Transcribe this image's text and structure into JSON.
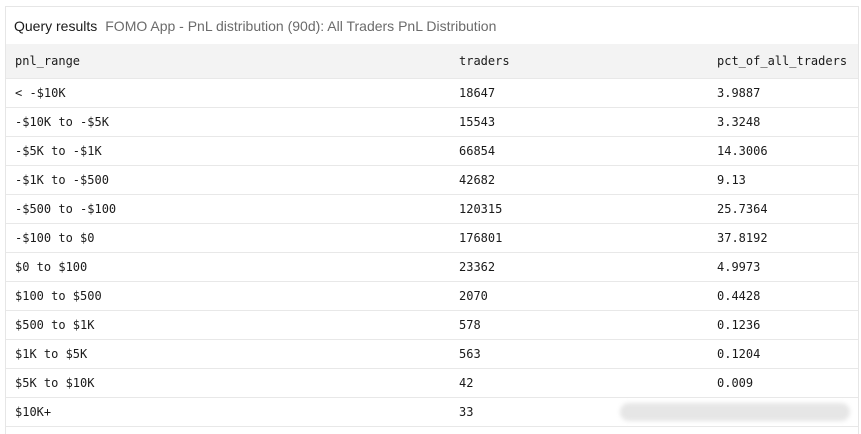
{
  "header": {
    "title": "Query results",
    "query_name": "FOMO App - PnL distribution (90d): All Traders PnL Distribution"
  },
  "table": {
    "columns": [
      "pnl_range",
      "traders",
      "pct_of_all_traders"
    ],
    "rows": [
      [
        "< -$10K",
        "18647",
        "3.9887"
      ],
      [
        "-$10K to -$5K",
        "15543",
        "3.3248"
      ],
      [
        "-$5K to -$1K",
        "66854",
        "14.3006"
      ],
      [
        "-$1K to -$500",
        "42682",
        "9.13"
      ],
      [
        "-$500 to -$100",
        "120315",
        "25.7364"
      ],
      [
        "-$100 to $0",
        "176801",
        "37.8192"
      ],
      [
        "$0 to $100",
        "23362",
        "4.9973"
      ],
      [
        "$100 to $500",
        "2070",
        "0.4428"
      ],
      [
        "$500 to $1K",
        "578",
        "0.1236"
      ],
      [
        "$1K to $5K",
        "563",
        "0.1204"
      ],
      [
        "$5K to $10K",
        "42",
        "0.009"
      ],
      [
        "$10K+",
        "33",
        ""
      ]
    ]
  }
}
